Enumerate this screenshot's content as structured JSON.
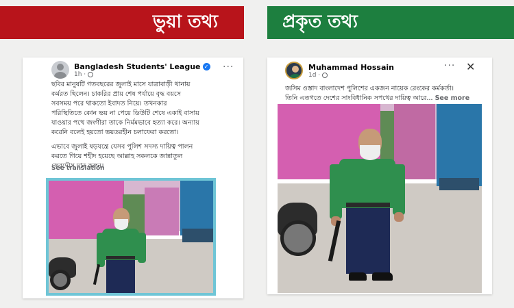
{
  "banners": {
    "fake_label": "ভুয়া তথ্য",
    "real_label": "প্রকৃত তথ্য",
    "fake_color": "#b8141b",
    "real_color": "#1d7f3f"
  },
  "left_post": {
    "author": "Bangladesh Students' League",
    "time": "1h ·",
    "verified": true,
    "text_lines": [
      "ছবির মানুষটি গতবছরের জুলাই মাসে যাত্রাবাড়ী থানায়",
      "কর্মরত ছিলেন। চাকরির প্রায় শেষ পর্যায়ে বৃদ্ধ বয়সে",
      "সবসময় পরে থাকতো ইবাদত নিয়ে। তখনকার",
      "পরিস্থিতিতে কোন ভয় না পেয়ে ডিউটি শেষে একাই বাসায়",
      "যাওয়ার পথে জংগীরা তাকে নির্মমভাবে হত্যা করে। অন্যায়",
      "করেনি বলেই হয়তো ভয়ডরহীন চলাফেরা করতো।"
    ],
    "text_lines_2": [
      "এভাবে জুলাই ষড়যন্ত্রে যেসব পুলিশ সদস্য দায়িত্ব পালন",
      "করতে গিয়ে শহীদ হয়েছে আল্লাহ সকলকে জান্নাতুল",
      "ফেরদৌস দান করুন।"
    ],
    "see_translation": "See translation",
    "menu_icon": "more-dots-icon"
  },
  "right_post": {
    "author": "Muhammad Hossain",
    "time": "1d ·",
    "text_line_1": "জসিম ওস্তাদ বাংলাদেশ পুলিশের একজন নায়েক রেংকের কর্মকর্তা।",
    "text_line_2": "তিনি এতগতে দেশের সাংবিধানিক সপথের দায়িত্ব আরে...",
    "see_more": "See more",
    "menu_icon": "more-dots-icon",
    "close_icon": "close-icon"
  }
}
